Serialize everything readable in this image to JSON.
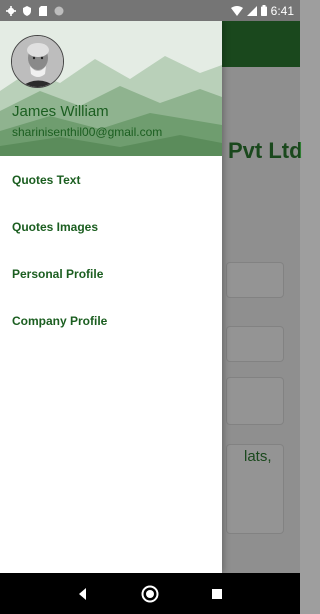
{
  "status_bar": {
    "time": "6:41",
    "left_icons": [
      "settings-icon",
      "shield-icon",
      "sd-card-icon",
      "circle-icon"
    ],
    "right_icons": [
      "wifi-icon",
      "signal-icon",
      "battery-icon"
    ]
  },
  "background": {
    "title_partial": "Pvt Ltd",
    "card_text_line1": "lats,",
    "accent_color": "#2e7d32"
  },
  "drawer": {
    "user_name": "James William",
    "user_email": "sharinisenthil00@gmail.com",
    "menu": [
      {
        "label": "Quotes Text"
      },
      {
        "label": "Quotes Images"
      },
      {
        "label": "Personal Profile"
      },
      {
        "label": "Company Profile"
      }
    ],
    "text_color": "#1b5e20"
  },
  "nav_bar": {
    "buttons": [
      "back-icon",
      "home-icon",
      "recents-icon"
    ]
  }
}
